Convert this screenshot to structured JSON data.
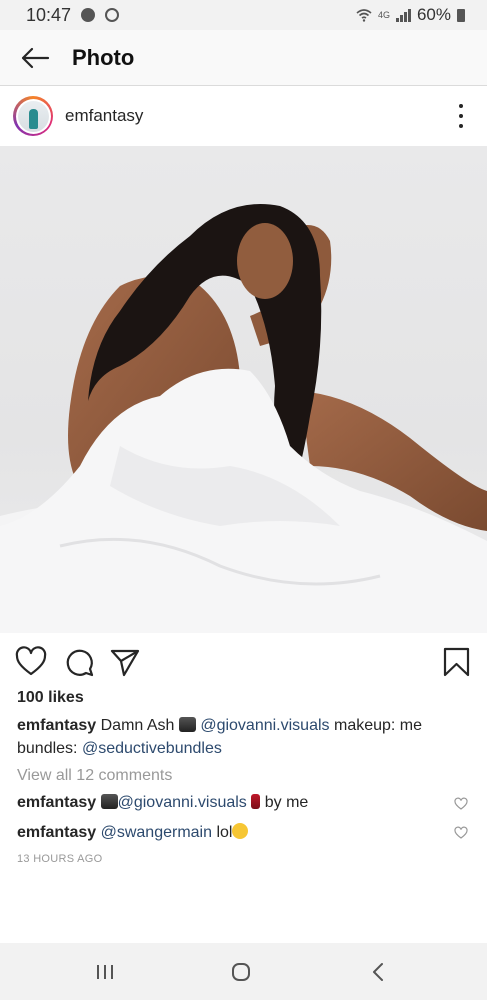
{
  "status_bar": {
    "time": "10:47",
    "network": "4G",
    "battery": "60%"
  },
  "app_bar": {
    "title": "Photo"
  },
  "post": {
    "username": "emfantasy",
    "likes": "100 likes",
    "caption": {
      "author": "emfantasy",
      "text_1": "Damn Ash",
      "mention_1": "@giovanni.visuals",
      "text_2": "makeup: me  bundles:",
      "mention_2": "@seductivebundles"
    },
    "view_all_comments": "View all 12 comments",
    "comments": [
      {
        "author": "emfantasy",
        "mention": "@giovanni.visuals",
        "text": "by me"
      },
      {
        "author": "emfantasy",
        "mention": "@swangermain",
        "text": "lol"
      }
    ],
    "timestamp": "13 HOURS AGO"
  },
  "icons": {
    "back": "arrow-left-icon",
    "more": "more-vertical-icon",
    "like": "heart-icon",
    "comment": "comment-icon",
    "share": "send-icon",
    "save": "bookmark-icon"
  },
  "colors": {
    "mention": "#2d4a6e",
    "muted": "#999999",
    "text": "#262626"
  }
}
